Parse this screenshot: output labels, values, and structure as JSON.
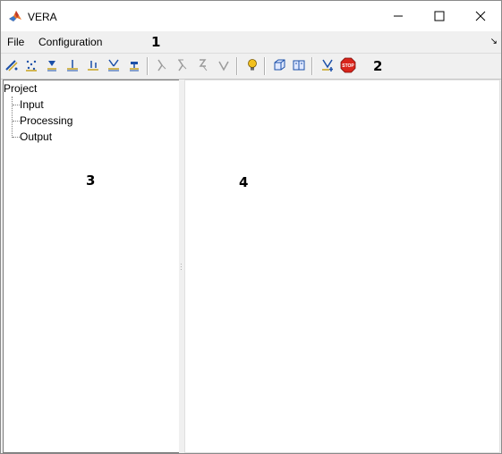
{
  "window": {
    "title": "VERA",
    "controls": {
      "minimize": "minimize-icon",
      "maximize": "maximize-icon",
      "close": "close-icon"
    }
  },
  "menubar": {
    "items": [
      {
        "label": "File"
      },
      {
        "label": "Configuration"
      }
    ],
    "overflow_arrow": "↘"
  },
  "toolbar": {
    "group1": [
      "pencil-dot-icon",
      "scatter-points-icon",
      "marker-down-icon",
      "baseline-marker-icon",
      "vertical-marker-icon",
      "cluster-marker-icon",
      "tool-marker-icon"
    ],
    "group2": [
      "probe-1-icon",
      "probe-2-icon",
      "probe-3-icon",
      "probe-4-icon"
    ],
    "group3": [
      "lightbulb-icon"
    ],
    "group4": [
      "3d-box-icon",
      "panel-view-icon"
    ],
    "group5": [
      "run-icon",
      "stop-icon"
    ],
    "stop_label": "STOP"
  },
  "tree": {
    "root": "Project",
    "children": [
      "Input",
      "Processing",
      "Output"
    ]
  },
  "annotations": [
    "1",
    "2",
    "3",
    "4"
  ],
  "colors": {
    "stop": "#d9251c",
    "bulb": "#f2c01e",
    "icon_blue": "#1b4fa8"
  }
}
